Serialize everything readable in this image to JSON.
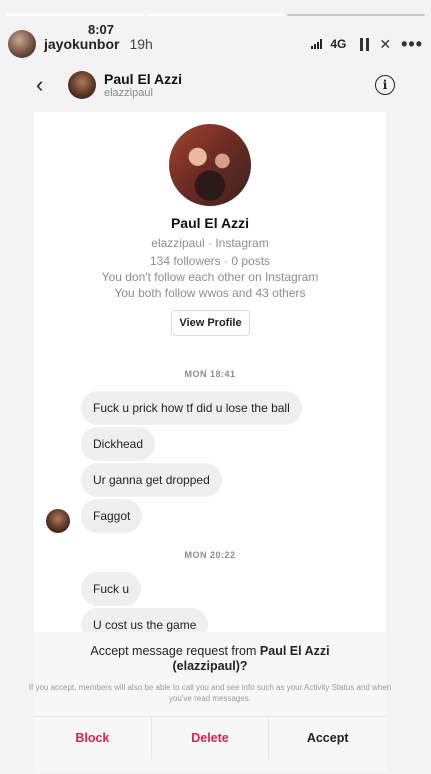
{
  "story": {
    "username": "jayokunbor",
    "time_ago": "19h",
    "clock": "8:07",
    "network": "4G",
    "progress_segments": [
      true,
      true,
      false
    ]
  },
  "dm_header": {
    "name": "Paul El Azzi",
    "handle": "elazzipaul"
  },
  "profile": {
    "name": "Paul El Azzi",
    "source": "elazzipaul · Instagram",
    "stats": "134 followers · 0 posts",
    "follow_status": "You don't follow each other on Instagram",
    "mutuals": "You both follow wwos and 43 others",
    "view_profile_label": "View Profile"
  },
  "messages": [
    {
      "timestamp": "MON 18:41"
    },
    {
      "text": "Fuck u prick how tf did u lose the ball"
    },
    {
      "text": "Dickhead"
    },
    {
      "text": "Ur ganna get dropped"
    },
    {
      "text": "Faggot"
    },
    {
      "timestamp": "MON 20:22"
    },
    {
      "text": "Fuck u"
    },
    {
      "text": "U cost us the game"
    }
  ],
  "request": {
    "prefix": "Accept message request from ",
    "name": "Paul El Azzi",
    "handle": "(elazzipaul)?",
    "description": "If you accept, members will also be able to call you and see info such as your Activity Status and when you've read messages.",
    "block_label": "Block",
    "delete_label": "Delete",
    "accept_label": "Accept"
  }
}
